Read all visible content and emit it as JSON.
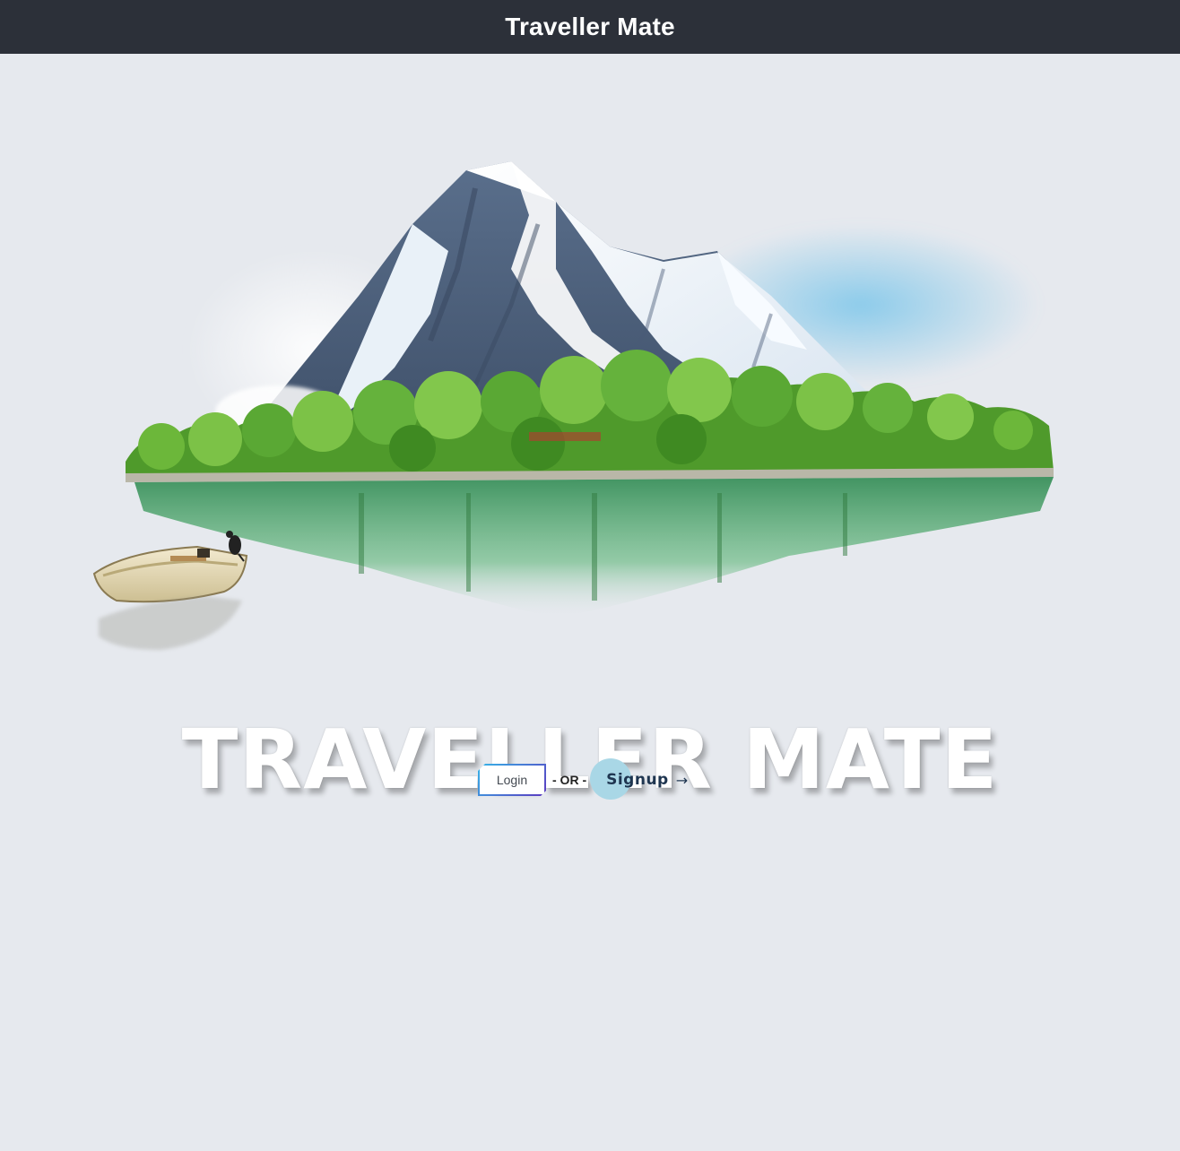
{
  "navbar": {
    "title": "Traveller Mate"
  },
  "hero": {
    "title": "TRAVELLER MATE",
    "image_icon": "mountain-island-illustration"
  },
  "actions": {
    "login_label": "Login",
    "or_text": "- OR -",
    "signup_label": "Signup",
    "signup_arrow": "→"
  },
  "colors": {
    "navbar_bg": "#2c3039",
    "page_bg": "#e6e9ee",
    "signup_circle": "#a9d7e6",
    "signup_text": "#1e3550",
    "login_border_start": "#36b4e8",
    "login_border_end": "#5b3bc0"
  }
}
